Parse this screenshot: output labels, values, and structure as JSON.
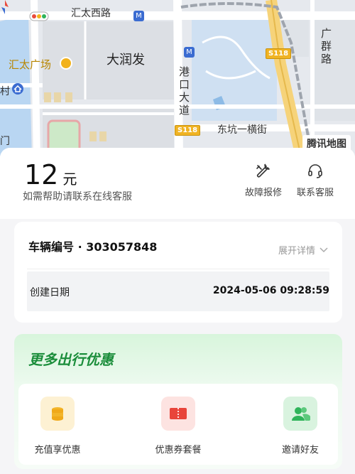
{
  "map": {
    "road_huitai_west": "汇太西路",
    "area_darunfa": "大润发",
    "poi_huitai_plaza": "汇太广场",
    "road_gangkou_avenue": "港口大道",
    "road_dongkeng_1st": "东坑一横街",
    "road_guangqun": "广群路",
    "shield_s118_top": "S118",
    "shield_s118_bottom": "S118",
    "edge_cun": "村",
    "edge_men": "门",
    "watermark": "腾讯地图",
    "colors": {
      "road": "#ffffff",
      "highway": "#f6d37a",
      "water": "#b9d6f2",
      "green": "#cde9c8",
      "block": "#dfe2e6",
      "ring": "#9ea4ad"
    }
  },
  "fare": {
    "amount": "12",
    "unit": "元",
    "help_text": "如需帮助请联系在线客服"
  },
  "actions": {
    "repair_label": "故障报修",
    "repair_icon": "wrench-icon",
    "service_label": "联系客服",
    "service_icon": "headset-icon"
  },
  "vehicle": {
    "title": "车辆编号 · 303057848",
    "expand_label": "展开详情",
    "created_label": "创建日期",
    "created_value": "2024-05-06 09:28:59"
  },
  "promo": {
    "title": "更多出行优惠",
    "items": [
      {
        "label": "充值享优惠",
        "icon": "coin-stack-icon",
        "color": "#f3b52a"
      },
      {
        "label": "优惠券套餐",
        "icon": "coupon-icon",
        "color": "#e8443a"
      },
      {
        "label": "邀请好友",
        "icon": "friends-icon",
        "color": "#2fb45a"
      }
    ]
  },
  "accent": "#1a8d3a"
}
